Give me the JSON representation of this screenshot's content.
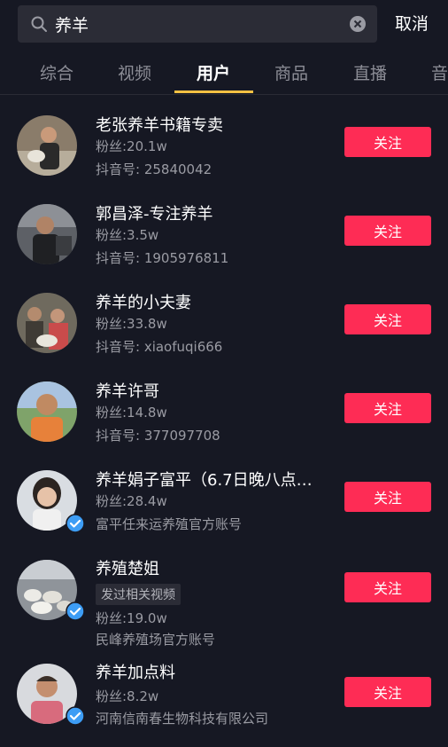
{
  "search": {
    "value": "养羊",
    "cancel_label": "取消"
  },
  "tabs": [
    {
      "label": "综合"
    },
    {
      "label": "视频"
    },
    {
      "label": "用户"
    },
    {
      "label": "商品"
    },
    {
      "label": "直播"
    },
    {
      "label": "音"
    }
  ],
  "active_tab": "用户",
  "colors": {
    "accent": "#fe2c55",
    "tab_indicator": "#f5c143",
    "verified": "#3d9df5",
    "background": "#161823"
  },
  "users": [
    {
      "name": "老张养羊书籍专卖",
      "fans": "粉丝:20.1w",
      "line3": "抖音号: 25840042",
      "verified": false,
      "follow_label": "关注"
    },
    {
      "name": "郭昌泽-专注养羊",
      "fans": "粉丝:3.5w",
      "line3": "抖音号: 1905976811",
      "verified": false,
      "follow_label": "关注"
    },
    {
      "name": "养羊的小夫妻",
      "fans": "粉丝:33.8w",
      "line3": "抖音号: xiaofuqi666",
      "verified": false,
      "follow_label": "关注"
    },
    {
      "name": "养羊许哥",
      "fans": "粉丝:14.8w",
      "line3": "抖音号: 377097708",
      "verified": false,
      "follow_label": "关注"
    },
    {
      "name": "养羊娟子富平（6.7日晚八点…",
      "fans": "粉丝:28.4w",
      "line3": "富平任来运养殖官方账号",
      "verified": true,
      "follow_label": "关注"
    },
    {
      "name": "养殖楚姐",
      "tag": "发过相关视频",
      "fans": "粉丝:19.0w",
      "line3": "民峰养殖场官方账号",
      "verified": true,
      "follow_label": "关注"
    },
    {
      "name": "养羊加点料",
      "fans": "粉丝:8.2w",
      "line3": "河南信南春生物科技有限公司",
      "verified": true,
      "follow_label": "关注"
    }
  ]
}
